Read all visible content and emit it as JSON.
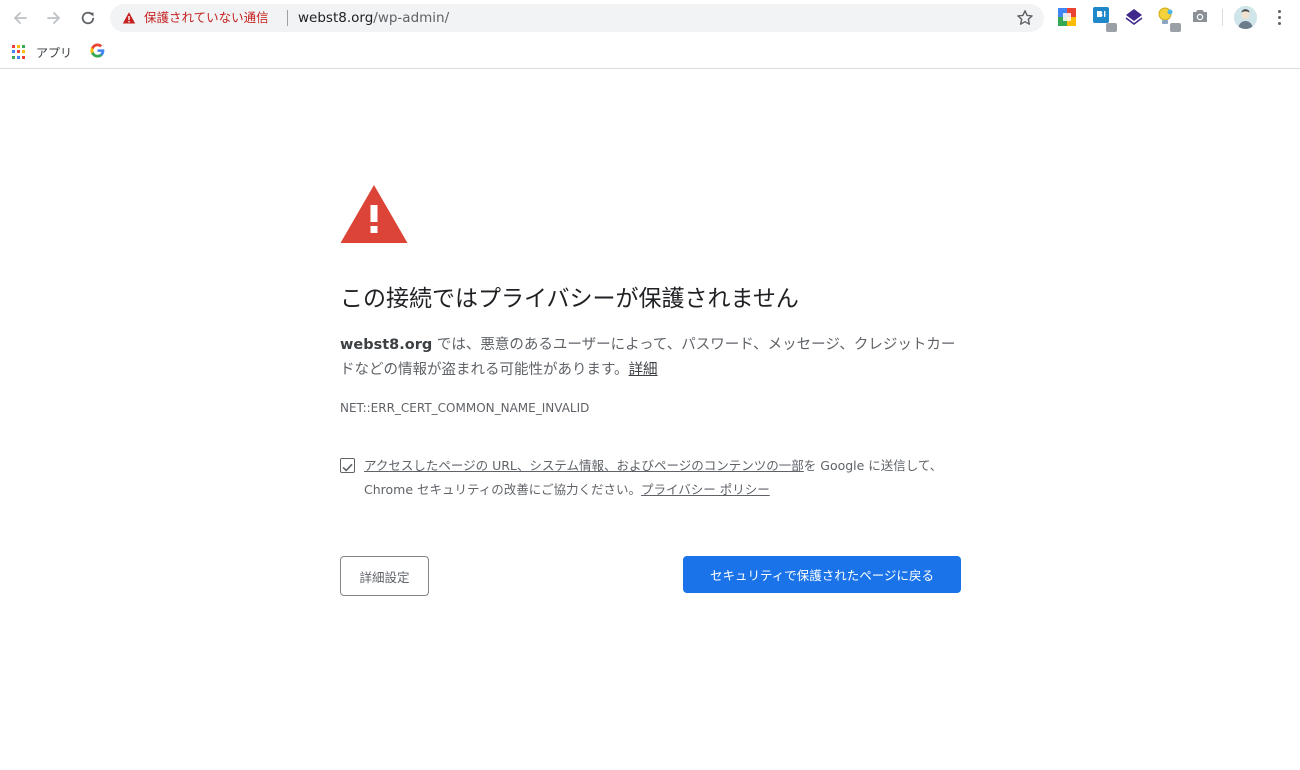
{
  "toolbar": {
    "security_chip": "保護されていない通信",
    "url_host": "webst8.org",
    "url_path": "/wp-admin/",
    "icons": {
      "back": "back-arrow-icon",
      "forward": "forward-arrow-icon",
      "reload": "reload-icon",
      "star": "star-icon",
      "menu": "kebab-menu-icon"
    },
    "colors": {
      "security_red": "#c5221f",
      "omnibox_bg": "#f1f3f4"
    }
  },
  "bookmarks": {
    "apps_label": "アプリ"
  },
  "interstitial": {
    "heading": "この接続ではプライバシーが保護されません",
    "explanation_host": "webst8.org",
    "explanation_text": " では、悪意のあるユーザーによって、パスワード、メッセージ、クレジットカードなどの情報が盗まれる可能性があります。",
    "details_link": "詳細",
    "error_code": "NET::ERR_CERT_COMMON_NAME_INVALID",
    "optin": {
      "checked": true,
      "link_text": "アクセスしたページの URL、システム情報、およびページのコンテンツの一部",
      "text_middle": "を Google に送信して、Chrome セキュリティの改善にご協力ください。",
      "privacy_link": "プライバシー ポリシー"
    },
    "advanced_button": "詳細設定",
    "back_button": "セキュリティで保護されたページに戻る",
    "colors": {
      "warning_red": "#db4437",
      "primary_blue": "#1a73e8"
    }
  }
}
